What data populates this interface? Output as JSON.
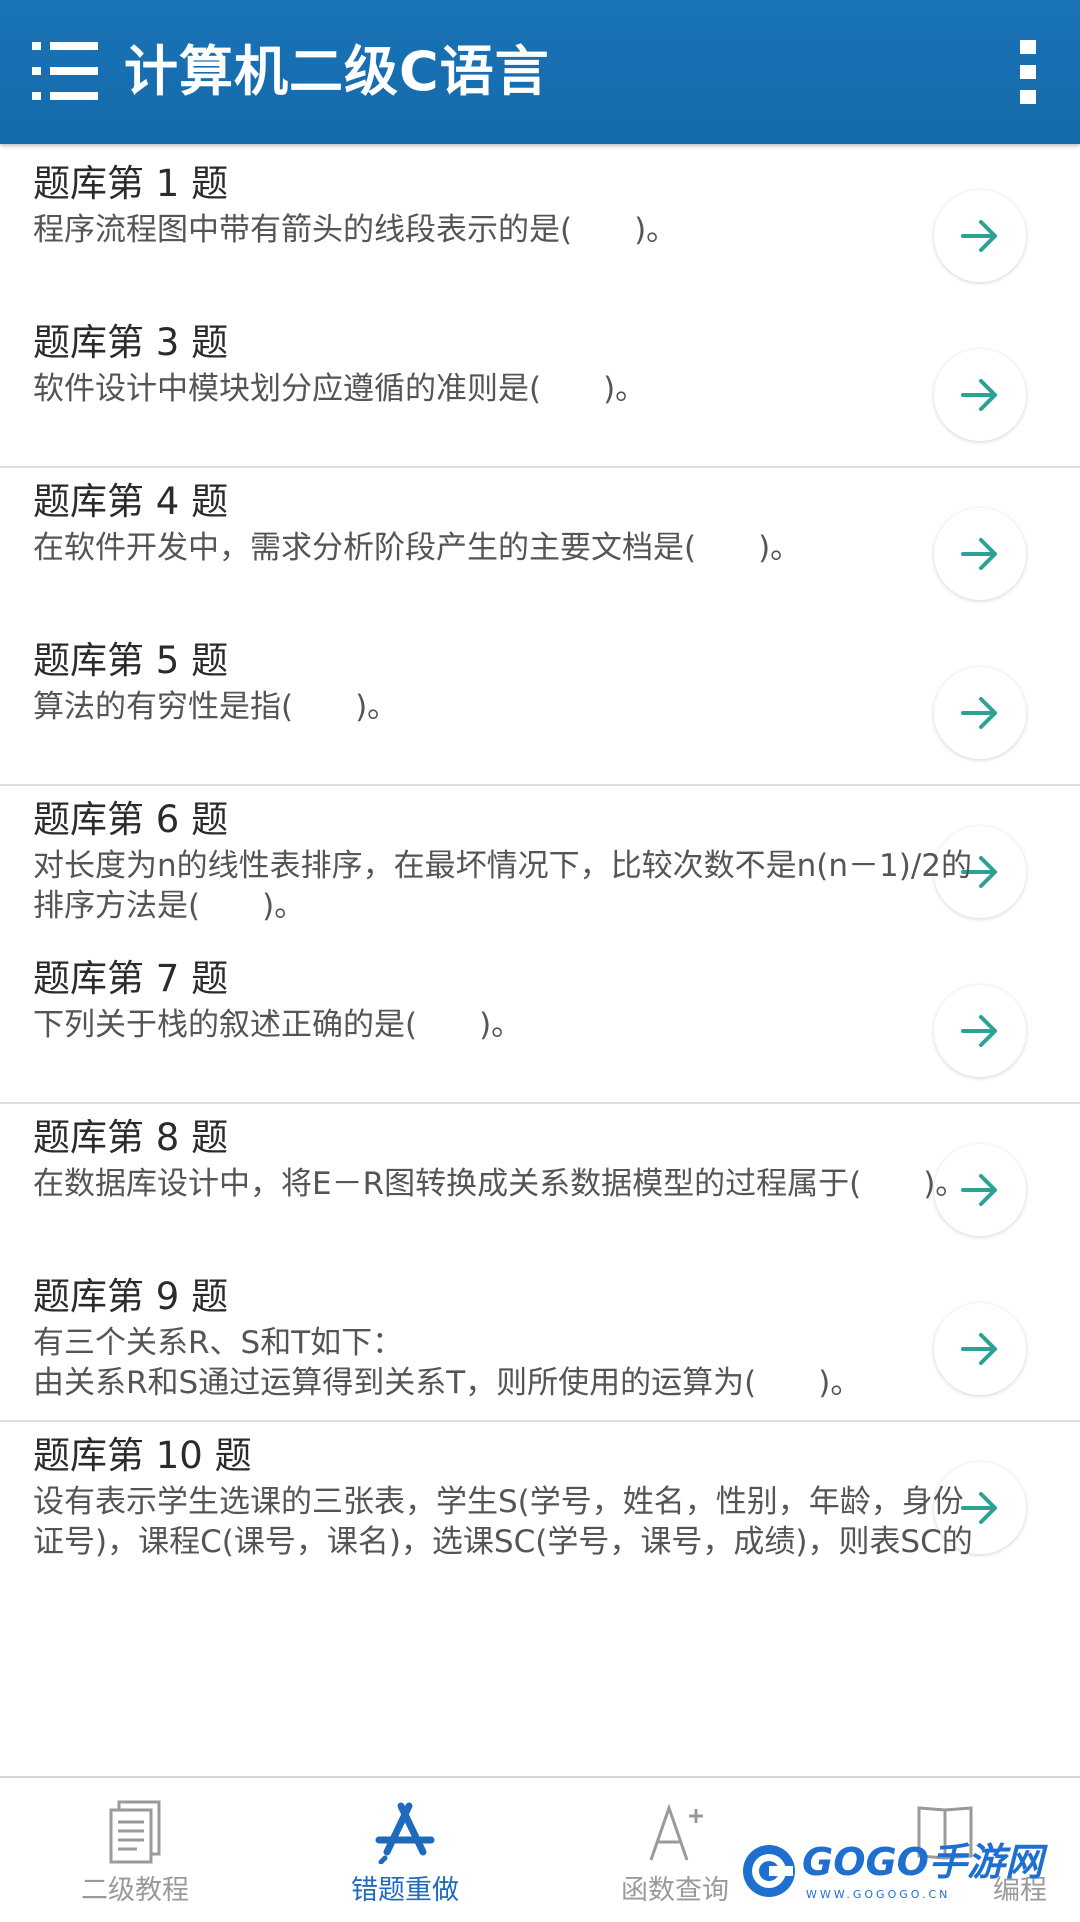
{
  "header": {
    "title": "计算机二级C语言",
    "menu_icon": "menu-icon",
    "overflow_icon": "more-vertical-icon",
    "color": "#1a73b8"
  },
  "questions": [
    {
      "title": "题库第 1 题",
      "text": "程序流程图中带有箭头的线段表示的是(　　)。"
    },
    {
      "title": "题库第 3 题",
      "text": "软件设计中模块划分应遵循的准则是(　　)。"
    },
    {
      "title": "题库第 4 题",
      "text": "在软件开发中，需求分析阶段产生的主要文档是(　　)。"
    },
    {
      "title": "题库第 5 题",
      "text": "算法的有穷性是指(　　)。"
    },
    {
      "title": "题库第 6 题",
      "text": "对长度为n的线性表排序，在最坏情况下，比较次数不是n(n－1)/2的\n排序方法是(　　)。"
    },
    {
      "title": "题库第 7 题",
      "text": "下列关于栈的叙述正确的是(　　)。"
    },
    {
      "title": "题库第 8 题",
      "text": "在数据库设计中，将E－R图转换成关系数据模型的过程属于(　　)。"
    },
    {
      "title": "题库第 9 题",
      "text": "有三个关系R、S和T如下：\n由关系R和S通过运算得到关系T，则所使用的运算为(　　)。"
    },
    {
      "title": "题库第 10 题",
      "text": "设有表示学生选课的三张表，学生S(学号，姓名，性别，年龄，身份\n证号)，课程C(课号，课名)，选课SC(学号，课号，成绩)，则表SC的"
    }
  ],
  "arrow_icon": "arrow-right-icon",
  "arrow_color": "#2aa394",
  "bottom_nav": [
    {
      "label": "二级教程",
      "icon": "document-icon",
      "active": false
    },
    {
      "label": "错题重做",
      "icon": "app-store-icon",
      "active": true
    },
    {
      "label": "函数查询",
      "icon": "font-plus-icon",
      "active": false
    },
    {
      "label": "编程",
      "icon": "book-icon",
      "active": false
    }
  ],
  "active_color": "#1e6bbd",
  "watermark": {
    "text": "GOGO手游网",
    "url": "WWW.GOGOGO.CN"
  }
}
